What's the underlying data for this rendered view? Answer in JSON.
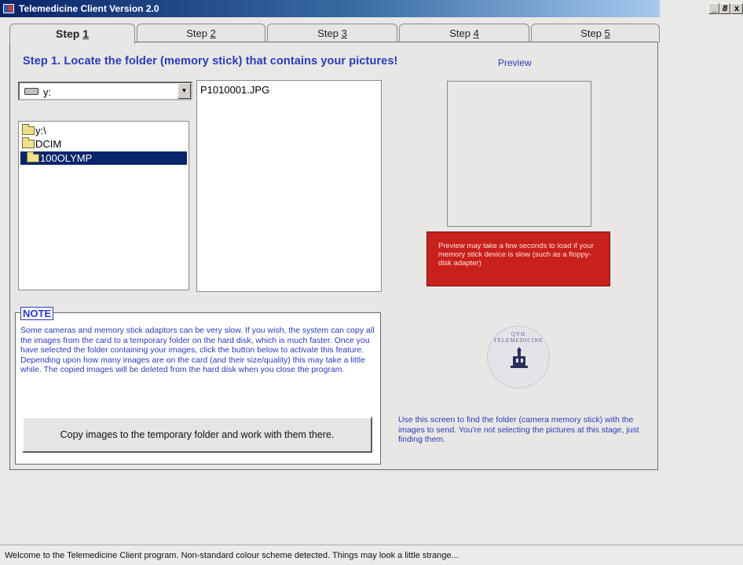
{
  "window": {
    "title": "Telemedicine Client Version 2.0",
    "minimize": "_",
    "maximize": "8",
    "close": "x"
  },
  "tabs": [
    {
      "label": "Step ",
      "key": "1",
      "active": true
    },
    {
      "label": "Step ",
      "key": "2",
      "active": false
    },
    {
      "label": "Step ",
      "key": "3",
      "active": false
    },
    {
      "label": "Step ",
      "key": "4",
      "active": false
    },
    {
      "label": "Step ",
      "key": "5",
      "active": false
    }
  ],
  "step1": {
    "heading": "Step 1. Locate the folder (memory stick) that contains your pictures!",
    "preview_label": "Preview",
    "drive": {
      "value": "y:",
      "icon": "drive-icon"
    },
    "folders": [
      {
        "label": "y:\\",
        "selected": false,
        "icon": "open-folder-icon"
      },
      {
        "label": "DCIM",
        "selected": false,
        "icon": "folder-icon"
      },
      {
        "label": "100OLYMP",
        "selected": true,
        "icon": "open-folder-icon"
      }
    ],
    "files": [
      "P1010001.JPG"
    ],
    "preview_warning": "Preview may take a few seconds to load if your memory stick device is slow (such as a floppy-disk adapter)",
    "note": {
      "label": "NOTE",
      "text": "Some cameras and memory stick adaptors can be very slow. If you wish, the system can copy all the images from the card to a temporary folder on the hard disk, which is much faster. Once you have selected the folder containing your images, click the button below to activate this feature. Depending upon how many images are on the card (and their size/quality) this may take a little while. The copied images will be deleted from the hard disk when you close the program.",
      "button": "Copy images to the temporary folder and work with them there."
    },
    "logo_text": "QVH TELEMEDICINE",
    "help_text": "Use this screen to find the folder (camera memory stick) with the images to send. You're not selecting the pictures at this stage, just finding them."
  },
  "status": "Welcome to the Telemedicine Client program. Non-standard colour scheme detected. Things may look a little strange...",
  "colors": {
    "accent_text": "#2a3bb8",
    "warning_bg": "#c8201a",
    "selection_bg": "#0a246a"
  }
}
